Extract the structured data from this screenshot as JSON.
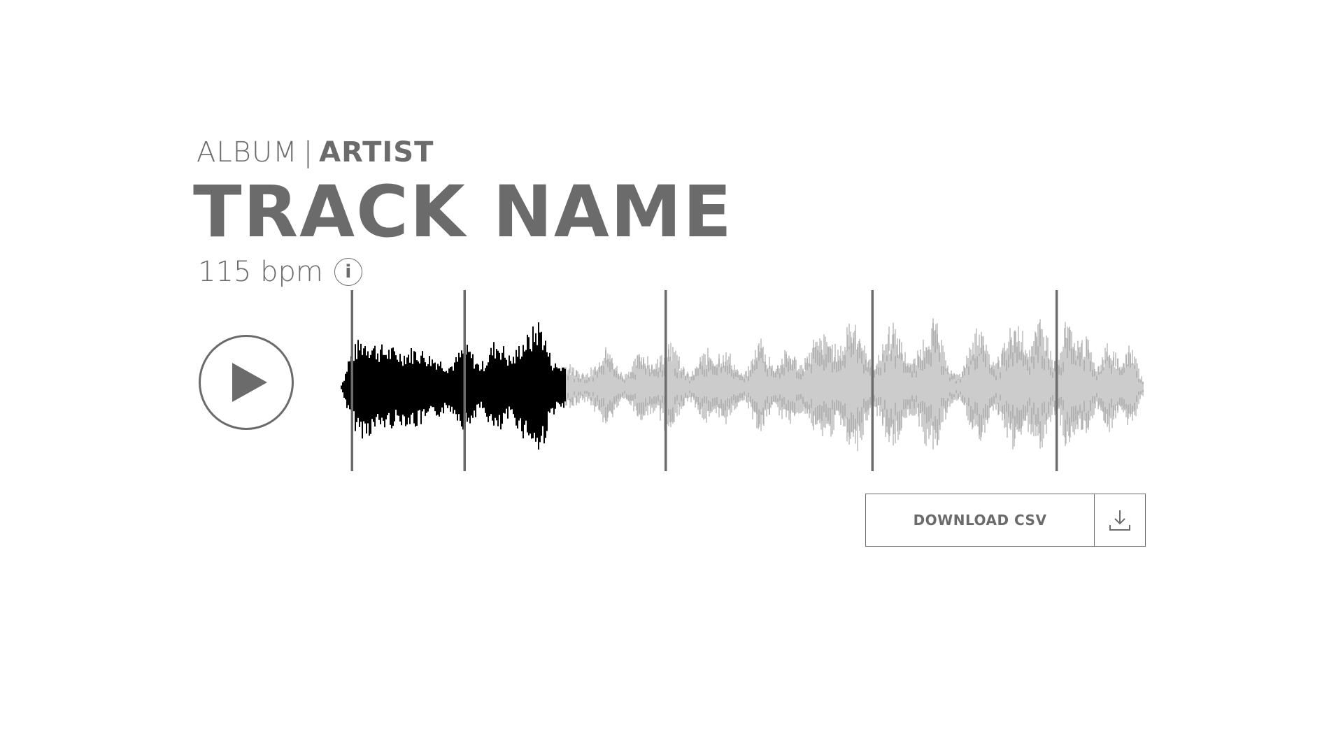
{
  "track": {
    "album": "ALBUM",
    "separator": "|",
    "artist": "ARTIST",
    "title": "TRACK NAME",
    "tempo": "115 bpm",
    "info_glyph": "i"
  },
  "player": {
    "play_icon": "play-icon",
    "played_fraction": 0.28,
    "beat_markers_fraction": [
      0.015,
      0.155,
      0.405,
      0.662,
      0.891
    ]
  },
  "download": {
    "label": "DOWNLOAD CSV",
    "icon": "download-icon"
  },
  "colors": {
    "text": "#6b6b6b",
    "played": "#000000",
    "unplayed_fill": "#cccccc",
    "unplayed_peaks": "#9a9a9a",
    "marker": "#6b6b6b"
  }
}
